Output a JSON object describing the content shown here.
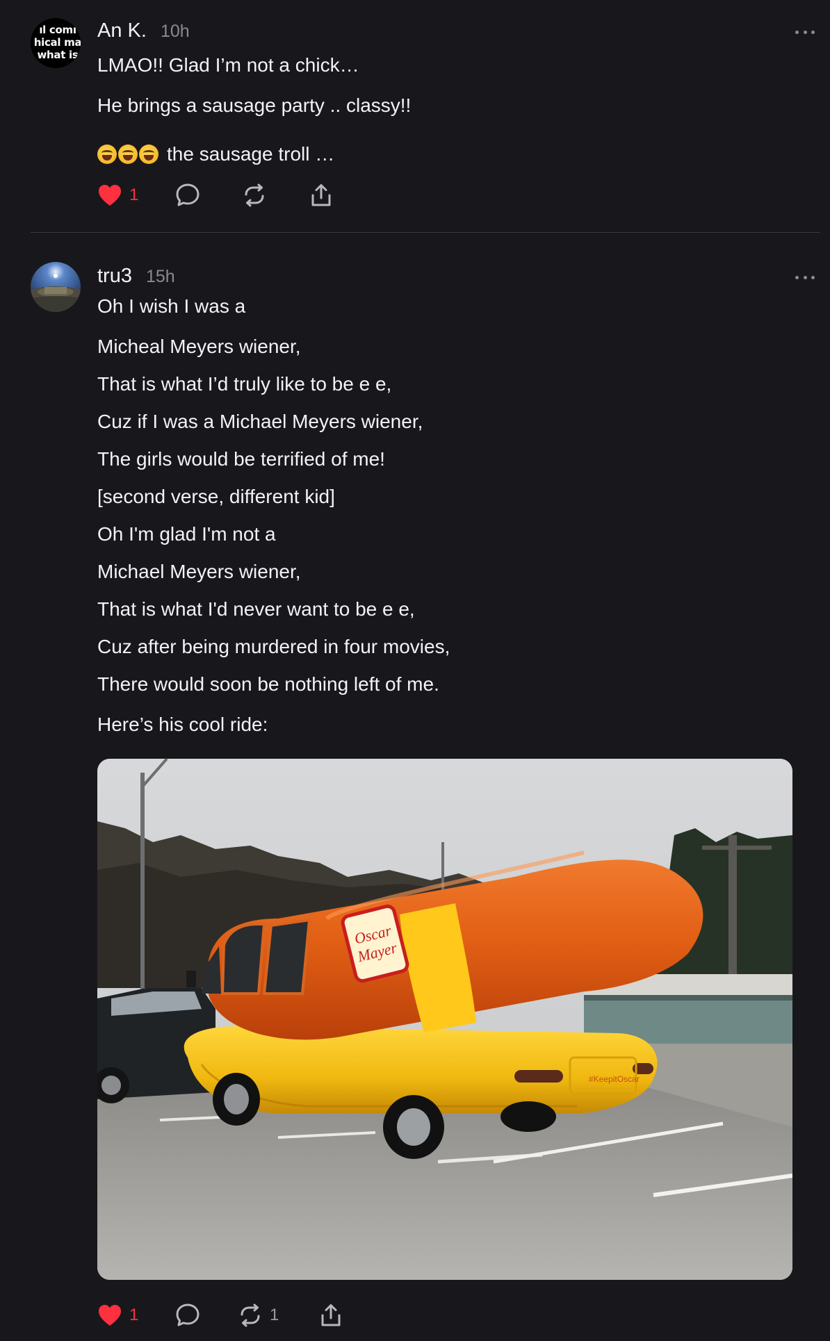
{
  "posts": [
    {
      "avatar_text": [
        "ıl comı",
        "hical ma",
        "what is"
      ],
      "username": "An K.",
      "time": "10h",
      "lines": [
        "LMAO!! Glad I’m not a chick…",
        "He brings a sausage party .. classy!!",
        "the sausage troll …"
      ],
      "likes": "1",
      "reposts": "",
      "emoji_icon": "rolling-laughing-emoji"
    },
    {
      "username": "tru3",
      "time": "15h",
      "lines": [
        "Oh I wish I was a",
        "Micheal Meyers wiener,",
        "That is what I’d truly like to be e e,",
        "Cuz if I was a Michael Meyers wiener,",
        "The girls would be terrified of me!",
        "[second verse, different kid]",
        "Oh I'm glad I'm not a",
        "Michael Meyers wiener,",
        "That is what I'd never want to be e e,",
        "Cuz after being murdered in four movies,",
        "There would soon be nothing left of me.",
        "Here’s his cool ride:"
      ],
      "photo": {
        "brand_text": [
          "Oscar",
          "Mayer"
        ],
        "plate_text": "#KeepitOscar"
      },
      "likes": "1",
      "reposts": "1"
    }
  ],
  "colors": {
    "background": "#18181c",
    "like": "#ff3040",
    "muted": "#8a8a92",
    "text": "#f3f3f5"
  },
  "icons": [
    "heart-icon",
    "comment-icon",
    "repost-icon",
    "share-icon",
    "more-icon"
  ]
}
